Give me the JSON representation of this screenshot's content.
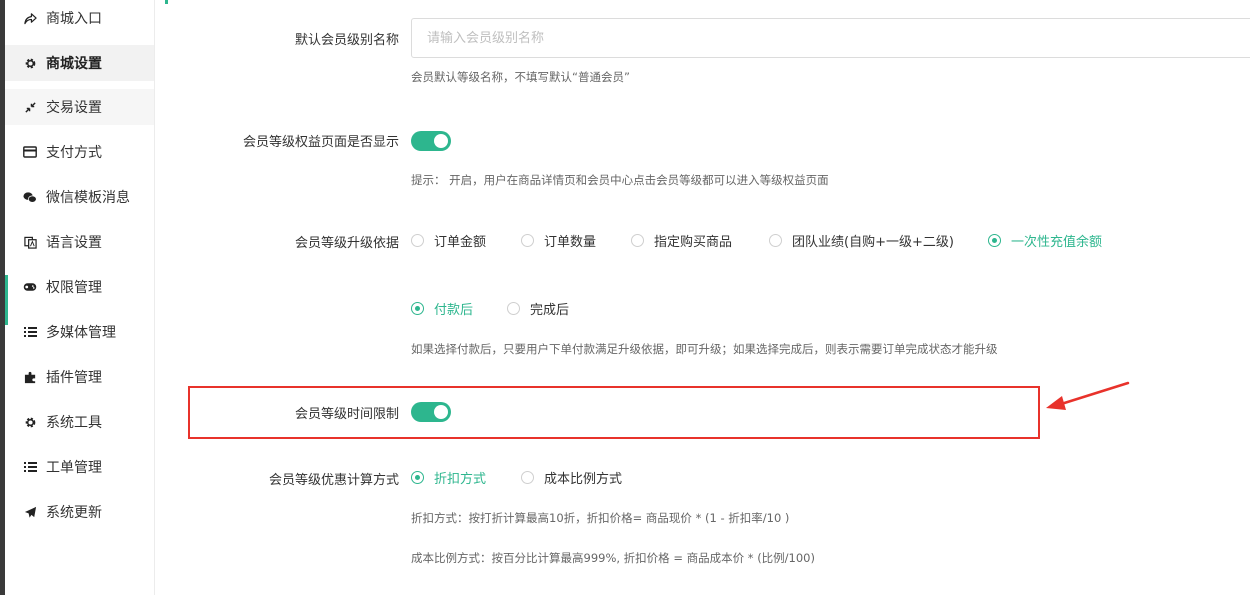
{
  "sidebar": {
    "items": [
      {
        "label": "商城入口",
        "icon": "share-icon"
      },
      {
        "label": "商城设置",
        "icon": "gear-icon",
        "active": true
      },
      {
        "label": "交易设置",
        "icon": "compress-icon"
      },
      {
        "label": "支付方式",
        "icon": "credit-card-icon"
      },
      {
        "label": "微信模板消息",
        "icon": "wechat-icon"
      },
      {
        "label": "语言设置",
        "icon": "language-icon"
      },
      {
        "label": "权限管理",
        "icon": "gamepad-icon"
      },
      {
        "label": "多媒体管理",
        "icon": "list-icon"
      },
      {
        "label": "插件管理",
        "icon": "puzzle-icon"
      },
      {
        "label": "系统工具",
        "icon": "gear-icon"
      },
      {
        "label": "工单管理",
        "icon": "list-icon"
      },
      {
        "label": "系统更新",
        "icon": "paper-plane-icon"
      }
    ]
  },
  "form": {
    "default_level_name": {
      "label": "默认会员级别名称",
      "placeholder": "请输入会员级别名称",
      "value": "",
      "hint": "会员默认等级名称，不填写默认“普通会员”"
    },
    "rights_page_display": {
      "label": "会员等级权益页面是否显示",
      "enabled": true,
      "hint": "提示： 开启，用户在商品详情页和会员中心点击会员等级都可以进入等级权益页面"
    },
    "upgrade_basis": {
      "label": "会员等级升级依据",
      "options": [
        "订单金额",
        "订单数量",
        "指定购买商品",
        "团队业绩(自购+一级+二级)",
        "一次性充值余额"
      ],
      "selected": "一次性充值余额",
      "timing_options": [
        "付款后",
        "完成后"
      ],
      "timing_selected": "付款后",
      "hint": "如果选择付款后，只要用户下单付款满足升级依据，即可升级；如果选择完成后，则表示需要订单完成状态才能升级"
    },
    "level_time_limit": {
      "label": "会员等级时间限制",
      "enabled": true
    },
    "discount_calc": {
      "label": "会员等级优惠计算方式",
      "options": [
        "折扣方式",
        "成本比例方式"
      ],
      "selected": "折扣方式",
      "hint1": "折扣方式：按打折计算最高10折，折扣价格= 商品现价 * (1 - 折扣率/10 )",
      "hint2": "成本比例方式：按百分比计算最高999%, 折扣价格 = 商品成本价 * (比例/100)"
    }
  },
  "colors": {
    "accent": "#2db68e",
    "highlight_box": "#e8322b"
  }
}
